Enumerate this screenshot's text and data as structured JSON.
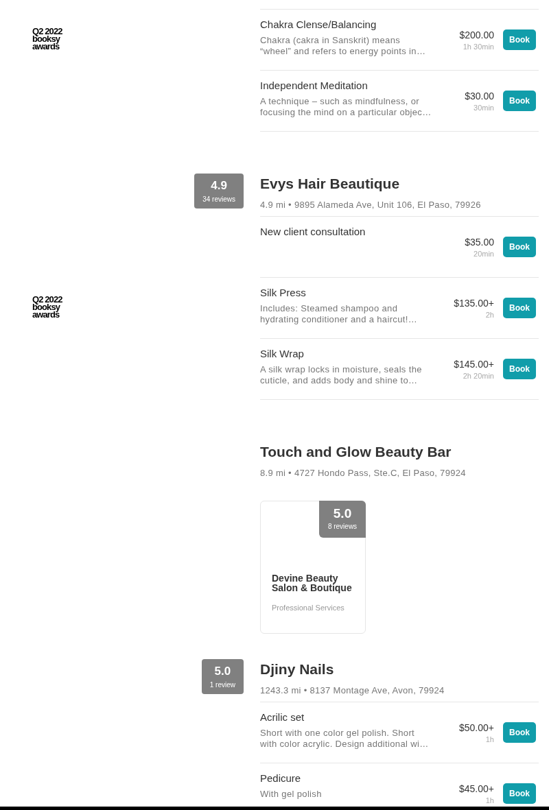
{
  "businesses": [
    {
      "award": {
        "lines": [
          "Q2 2022",
          "booksy",
          "awards"
        ]
      },
      "services": [
        {
          "name": "Chakra Clense/Balancing",
          "description": "Chakra (cakra in Sanskrit) means “wheel” and refers to energy points in…",
          "price": "$200.00",
          "duration": "1h 30min",
          "button": "Book"
        },
        {
          "name": "Independent Meditation",
          "description": "A technique – such as mindfulness, or focusing the mind on a particular objec…",
          "price": "$30.00",
          "duration": "30min",
          "button": "Book"
        }
      ]
    },
    {
      "rating": {
        "score": "4.9",
        "reviews": "34 reviews"
      },
      "award": {
        "lines": [
          "Q2 2022",
          "booksy",
          "awards"
        ]
      },
      "name": "Evys Hair Beautique",
      "address": "4.9 mi • 9895 Alameda Ave, Unit 106, El Paso, 79926",
      "services": [
        {
          "name": "New client consultation",
          "price": "$35.00",
          "duration": "20min",
          "button": "Book"
        },
        {
          "name": "Silk Press",
          "description": "Includes: Steamed shampoo and hydrating conditioner and a haircut!…",
          "price": "$135.00+",
          "duration": "2h",
          "button": "Book"
        },
        {
          "name": "Silk Wrap",
          "description": "A silk wrap locks in moisture, seals the cuticle, and adds body and shine to…",
          "price": "$145.00+",
          "duration": "2h 20min",
          "button": "Book"
        }
      ]
    },
    {
      "name": "Touch and Glow Beauty Bar",
      "address": "8.9 mi • 4727 Hondo Pass, Ste.C, El Paso, 79924",
      "cards": [
        {
          "rating": {
            "score": "5.0",
            "reviews": "8 reviews"
          },
          "title": "Devine Beauty Salon & Boutique",
          "category": "Professional Services"
        }
      ]
    },
    {
      "rating": {
        "score": "5.0",
        "reviews": "1 review"
      },
      "name": "Djiny Nails",
      "address": "1243.3 mi • 8137 Montage Ave, Avon, 79924",
      "services": [
        {
          "name": "Acrilic set",
          "description": "Short with one color gel polish. Short with color acrylic. Design additional wi…",
          "price": "$50.00+",
          "duration": "1h",
          "button": "Book"
        },
        {
          "name": "Pedicure",
          "description": "With gel polish",
          "price": "$45.00+",
          "duration": "1h",
          "button": "Book"
        }
      ]
    }
  ]
}
